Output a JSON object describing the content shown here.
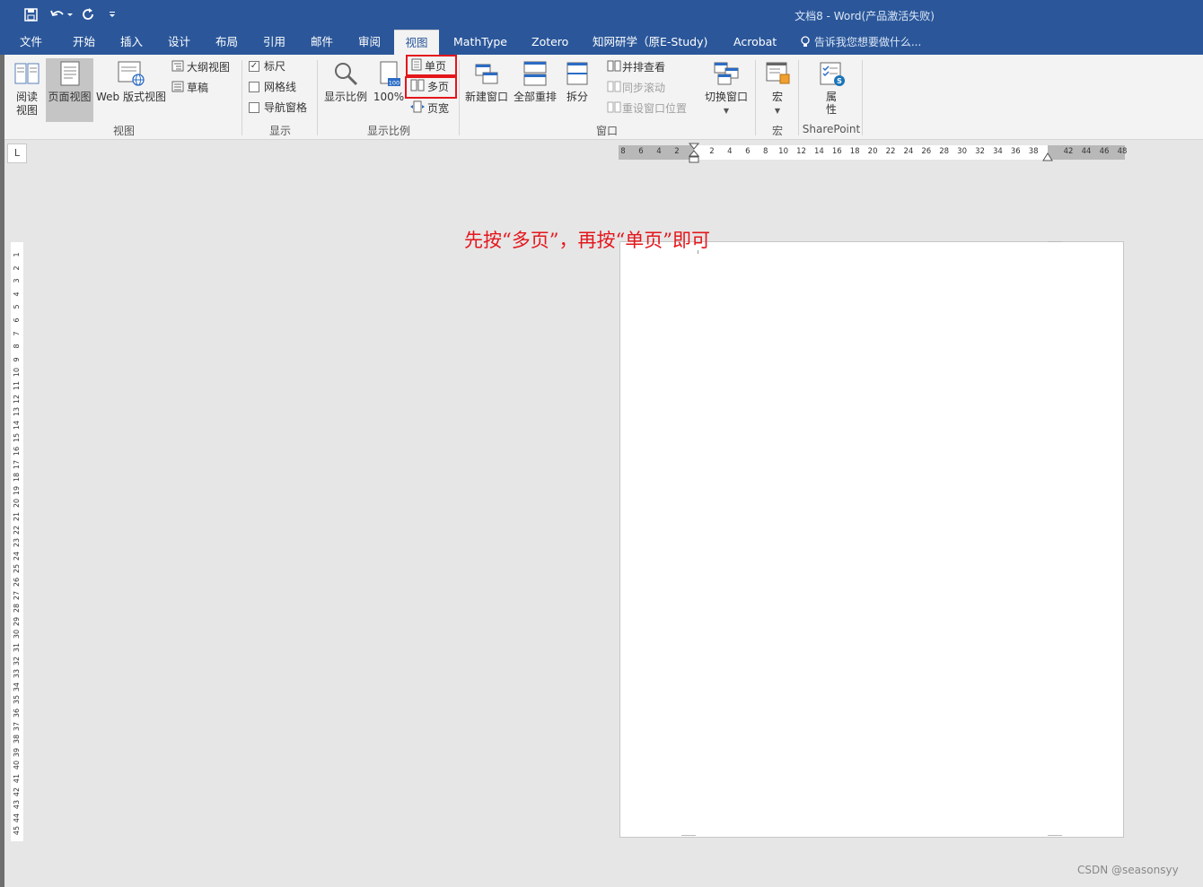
{
  "titlebar": {
    "title": "文档8 - Word(产品激活失败)",
    "qat": [
      "save-icon",
      "undo-icon",
      "redo-icon",
      "customize-icon"
    ]
  },
  "tabs": [
    "文件",
    "开始",
    "插入",
    "设计",
    "布局",
    "引用",
    "邮件",
    "审阅",
    "视图",
    "MathType",
    "Zotero",
    "知网研学（原E-Study)",
    "Acrobat"
  ],
  "tell_me": "告诉我您想要做什么...",
  "ribbon": {
    "views": {
      "read_mode": "阅读\n视图",
      "print_layout": "页面视图",
      "web_layout": "Web 版式视图",
      "outline": "大纲视图",
      "draft": "草稿",
      "label": "视图"
    },
    "show": {
      "ruler": "标尺",
      "gridlines": "网格线",
      "nav_pane": "导航窗格",
      "label": "显示"
    },
    "zoom": {
      "zoom": "显示比例",
      "hundred": "100%",
      "hundred_badge": "100",
      "one_page": "单页",
      "multi_page": "多页",
      "page_width": "页宽",
      "label": "显示比例"
    },
    "window": {
      "new_window": "新建窗口",
      "arrange_all": "全部重排",
      "split": "拆分",
      "side_by_side": "并排查看",
      "sync_scroll": "同步滚动",
      "reset_pos": "重设窗口位置",
      "switch": "切换窗口",
      "label": "窗口"
    },
    "macros": {
      "macros": "宏",
      "label": "宏"
    },
    "sharepoint": {
      "properties": "属\n性",
      "label": "SharePoint"
    }
  },
  "corner": "L",
  "hruler_left": [
    "8",
    "6",
    "4",
    "2"
  ],
  "hruler_right": [
    "2",
    "4",
    "6",
    "8",
    "10",
    "12",
    "14",
    "16",
    "18",
    "20",
    "22",
    "24",
    "26",
    "28",
    "30",
    "32",
    "34",
    "36",
    "38"
  ],
  "hruler_far": [
    "42",
    "44",
    "46",
    "48"
  ],
  "vruler": [
    "1",
    "2",
    "3",
    "4",
    "5",
    "6",
    "7",
    "8",
    "9",
    "10",
    "11",
    "12",
    "13",
    "14",
    "15",
    "16",
    "17",
    "18",
    "19",
    "20",
    "21",
    "22",
    "23",
    "24",
    "25",
    "26",
    "27",
    "28",
    "29",
    "30",
    "31",
    "32",
    "33",
    "34",
    "35",
    "36",
    "37",
    "38",
    "39",
    "40",
    "41",
    "42",
    "43",
    "44",
    "45"
  ],
  "annotation": "先按“多页”，再按“单页”即可",
  "watermark": "CSDN @seasonsyy",
  "colors": {
    "brand": "#2b579a",
    "highlight": "#e4161c"
  }
}
